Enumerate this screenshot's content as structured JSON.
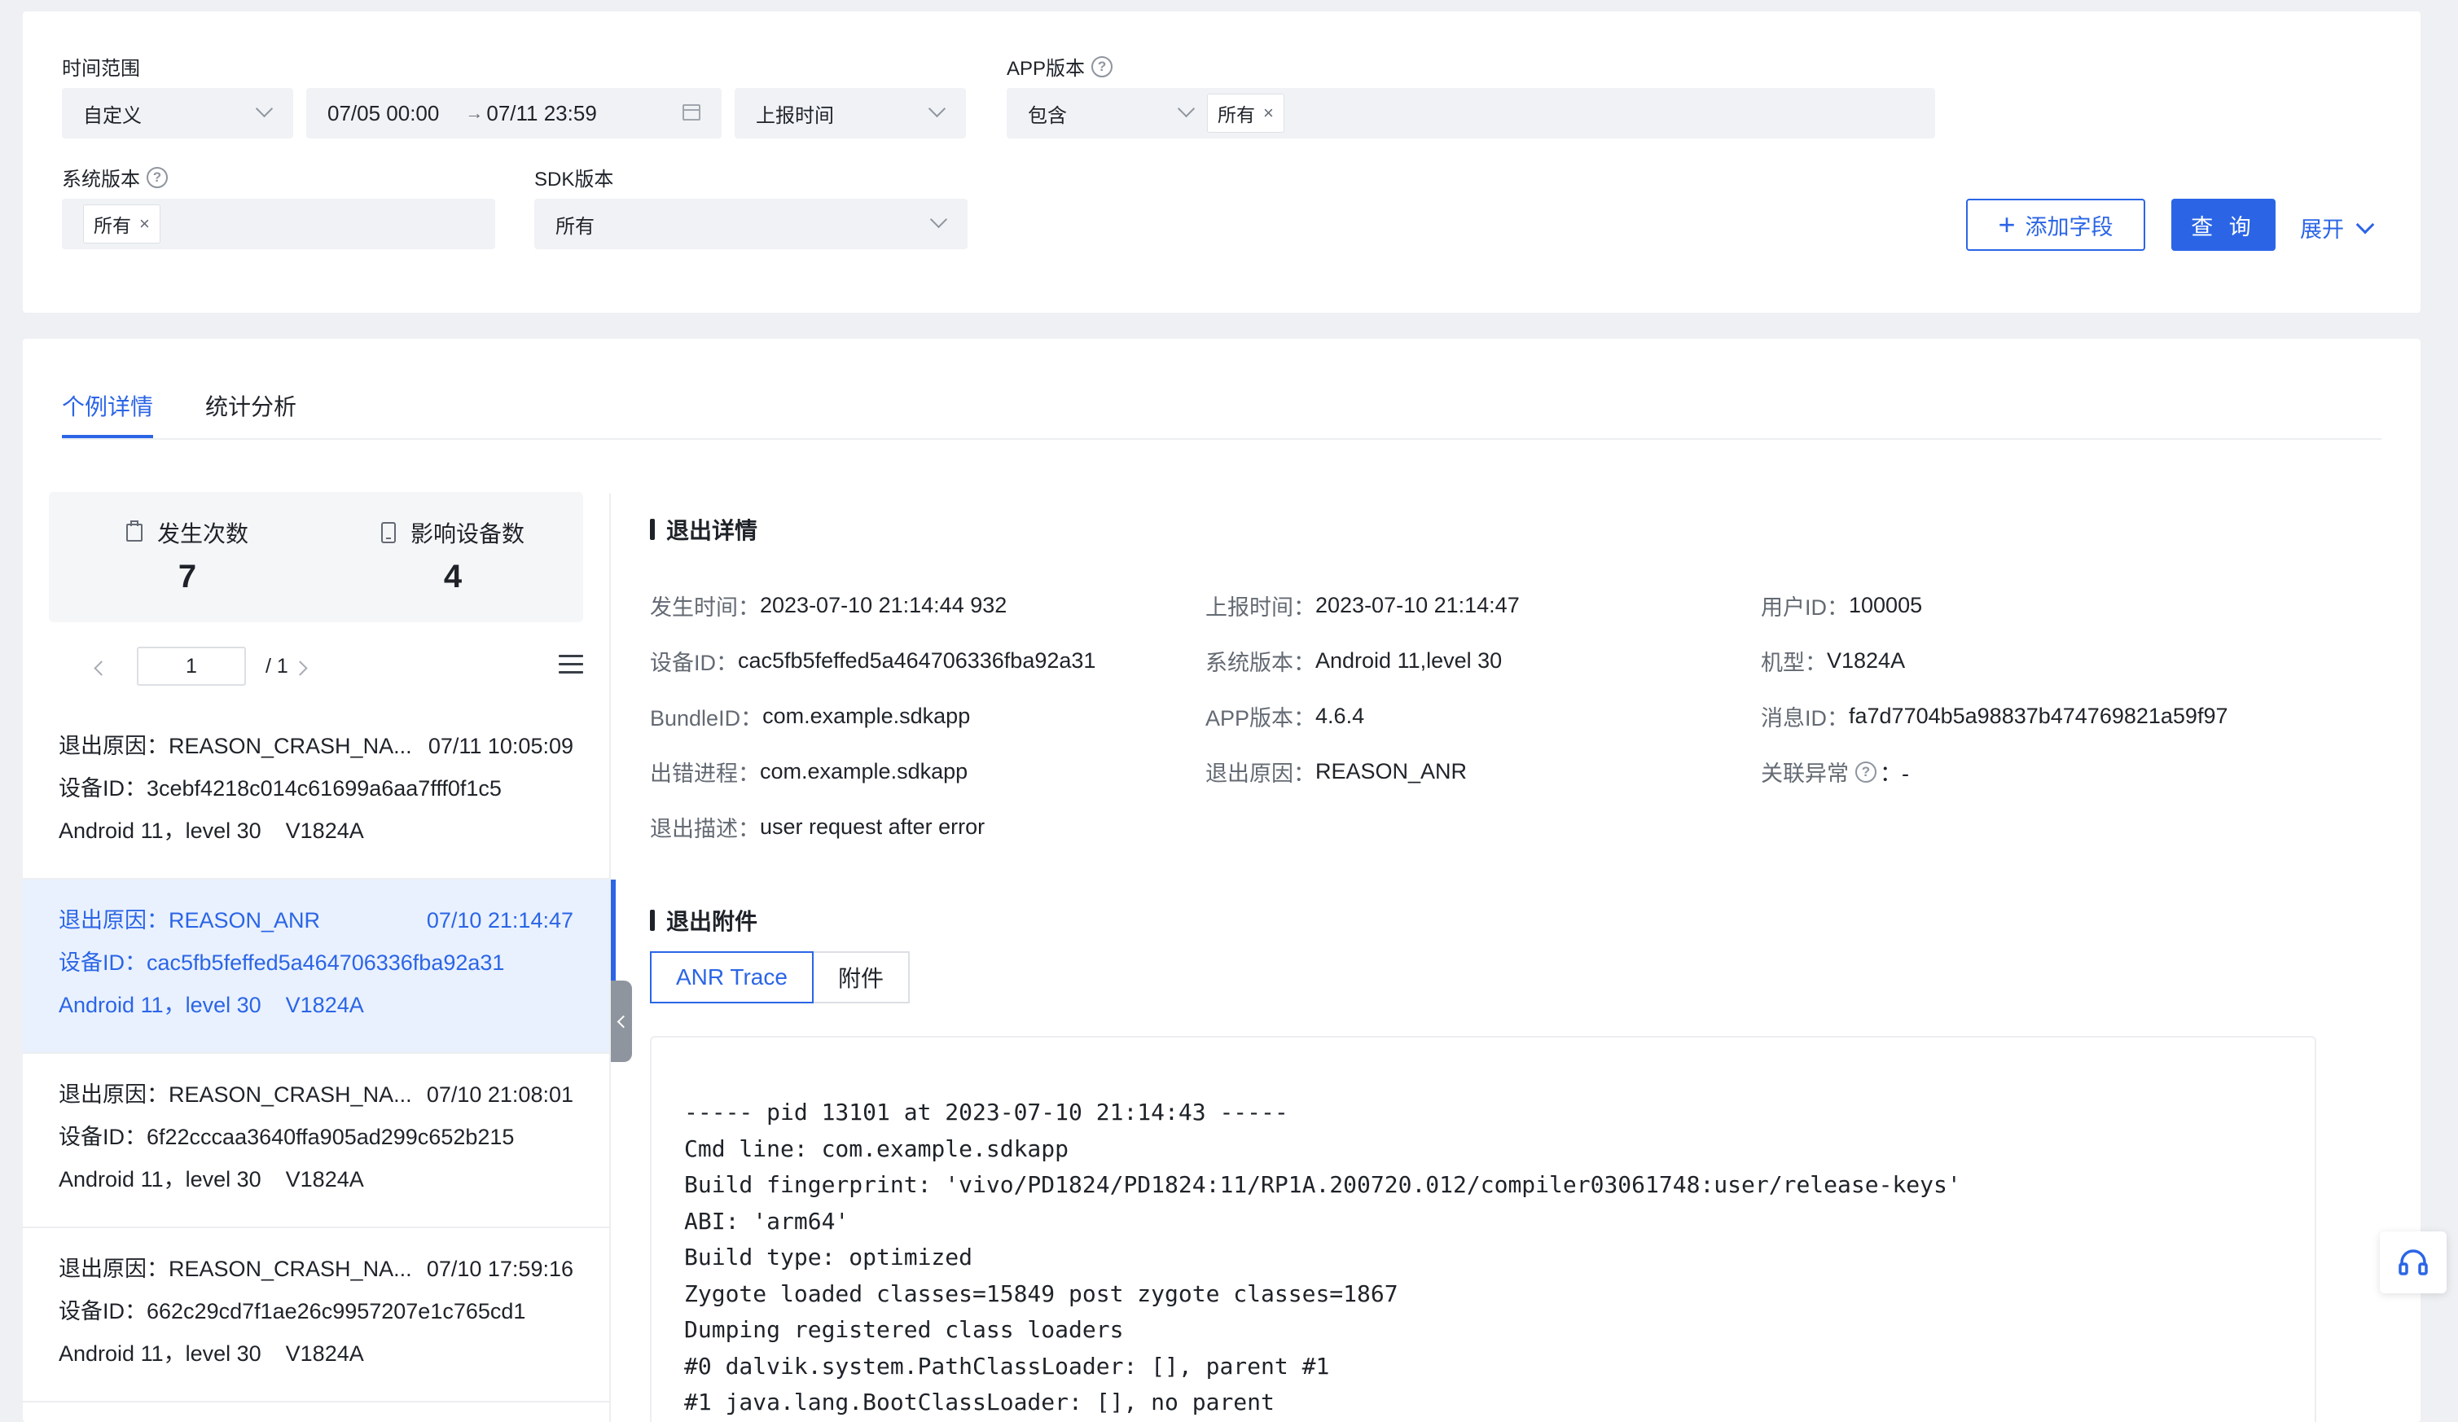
{
  "filters": {
    "time_range_label": "时间范围",
    "time_range_mode": "自定义",
    "date_start": "07/05 00:00",
    "date_sep": "→",
    "date_end": "07/11 23:59",
    "time_type": "上报时间",
    "app_version_label": "APP版本",
    "app_version_op": "包含",
    "app_version_tag": "所有",
    "os_version_label": "系统版本",
    "os_version_tag": "所有",
    "sdk_version_label": "SDK版本",
    "sdk_version_value": "所有",
    "add_field_label": "添加字段",
    "query_label": "查 询",
    "expand_label": "展开"
  },
  "tabs": [
    "个例详情",
    "统计分析"
  ],
  "stats": {
    "occurrences_label": "发生次数",
    "occurrences": "7",
    "devices_label": "影响设备数",
    "devices": "4"
  },
  "pager": {
    "current": "1",
    "total": "/ 1"
  },
  "list": [
    {
      "reason": "退出原因：REASON_CRASH_NA...",
      "time": "07/11 10:05:09",
      "device": "设备ID：3cebf4218c014c61699a6aa7fff0f1c5",
      "os": "Android 11，level 30",
      "model": "V1824A"
    },
    {
      "reason": "退出原因：REASON_ANR",
      "time": "07/10 21:14:47",
      "device": "设备ID：cac5fb5feffed5a464706336fba92a31",
      "os": "Android 11，level 30",
      "model": "V1824A"
    },
    {
      "reason": "退出原因：REASON_CRASH_NA...",
      "time": "07/10 21:08:01",
      "device": "设备ID：6f22cccaa3640ffa905ad299c652b215",
      "os": "Android 11，level 30",
      "model": "V1824A"
    },
    {
      "reason": "退出原因：REASON_CRASH_NA...",
      "time": "07/10 17:59:16",
      "device": "设备ID：662c29cd7f1ae26c9957207e1c765cd1",
      "os": "Android 11，level 30",
      "model": "V1824A"
    }
  ],
  "detail": {
    "title": "退出详情",
    "fields": {
      "occur_time_k": "发生时间：",
      "occur_time_v": "2023-07-10 21:14:44 932",
      "report_time_k": "上报时间：",
      "report_time_v": "2023-07-10 21:14:47",
      "user_id_k": "用户ID：",
      "user_id_v": "100005",
      "device_id_k": "设备ID：",
      "device_id_v": "cac5fb5feffed5a464706336fba92a31",
      "os_k": "系统版本：",
      "os_v": "Android 11,level 30",
      "model_k": "机型：",
      "model_v": "V1824A",
      "bundle_k": "BundleID：",
      "bundle_v": "com.example.sdkapp",
      "app_ver_k": "APP版本：",
      "app_ver_v": "4.6.4",
      "msg_id_k": "消息ID：",
      "msg_id_v": "fa7d7704b5a98837b474769821a59f97",
      "process_k": "出错进程：",
      "process_v": "com.example.sdkapp",
      "reason_k": "退出原因：",
      "reason_v": "REASON_ANR",
      "related_k": "关联异常",
      "related_v": "：-",
      "desc_k": "退出描述：",
      "desc_v": "user request after error"
    }
  },
  "attachments": {
    "title": "退出附件",
    "tabs": [
      "ANR Trace",
      "附件"
    ],
    "trace": "----- pid 13101 at 2023-07-10 21:14:43 -----\nCmd line: com.example.sdkapp\nBuild fingerprint: 'vivo/PD1824/PD1824:11/RP1A.200720.012/compiler03061748:user/release-keys'\nABI: 'arm64'\nBuild type: optimized\nZygote loaded classes=15849 post zygote classes=1867\nDumping registered class loaders\n#0 dalvik.system.PathClassLoader: [], parent #1\n#1 java.lang.BootClassLoader: [], no parent"
  },
  "icons": {
    "accent": "#2b65e6",
    "help": "help-icon",
    "calendar": "calendar-icon",
    "headset": "headset-icon"
  }
}
